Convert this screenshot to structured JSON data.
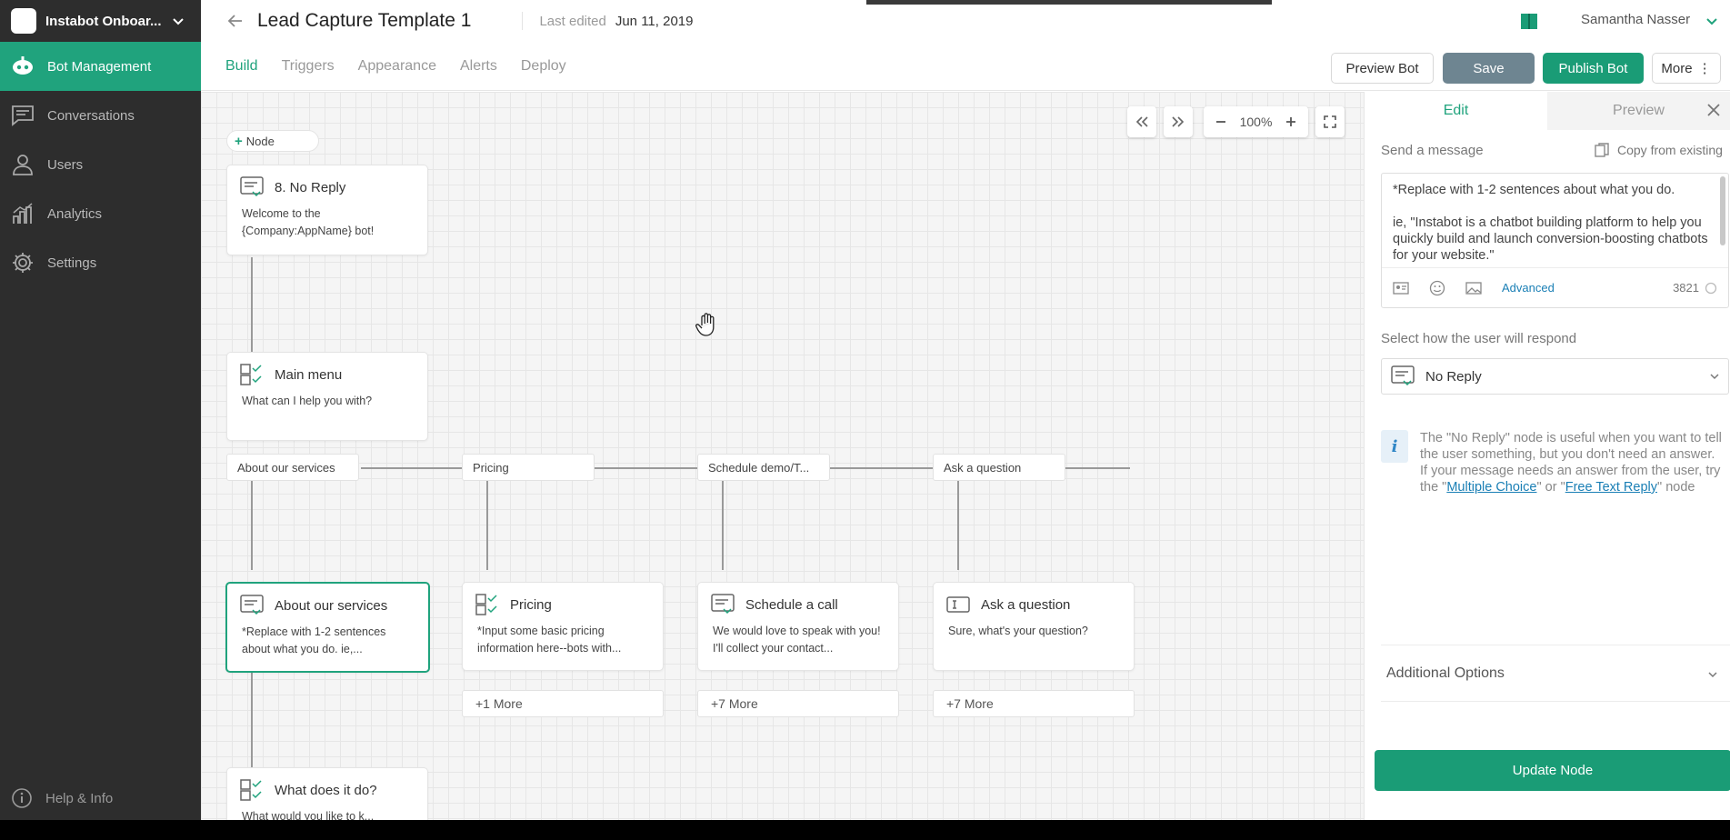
{
  "workspace": {
    "name": "Instabot Onboar..."
  },
  "sidebar": {
    "items": [
      {
        "label": "Bot Management",
        "icon": "bot-icon"
      },
      {
        "label": "Conversations",
        "icon": "chat-icon"
      },
      {
        "label": "Users",
        "icon": "user-icon"
      },
      {
        "label": "Analytics",
        "icon": "analytics-icon"
      },
      {
        "label": "Settings",
        "icon": "gear-icon"
      }
    ],
    "help_label": "Help & Info"
  },
  "header": {
    "title": "Lead Capture Template 1",
    "last_edited_label": "Last edited",
    "last_edited_date": "Jun 11, 2019",
    "user_name": "Samantha Nasser"
  },
  "tabs": [
    {
      "label": "Build"
    },
    {
      "label": "Triggers"
    },
    {
      "label": "Appearance"
    },
    {
      "label": "Alerts"
    },
    {
      "label": "Deploy"
    }
  ],
  "actions": {
    "preview": "Preview Bot",
    "save": "Save",
    "publish": "Publish Bot",
    "more": "More"
  },
  "canvas": {
    "zoom": "100%",
    "add_node_label": "Node",
    "nodes": {
      "no_reply": {
        "title": "8. No Reply",
        "body": "Welcome to the {Company:AppName} bot!"
      },
      "main_menu": {
        "title": "Main menu",
        "body": "What can I help you with?"
      },
      "about": {
        "title": "About our services",
        "body": "*Replace with 1-2 sentences about what you do. ie,..."
      },
      "pricing": {
        "title": "Pricing",
        "body": "*Input some basic pricing information here--bots with..."
      },
      "schedule": {
        "title": "Schedule a call",
        "body": "We would love to speak with you! I'll collect your contact..."
      },
      "ask": {
        "title": "Ask a question",
        "body": "Sure, what's your question?"
      },
      "what": {
        "title": "What does it do?",
        "body": "What would you like to k..."
      }
    },
    "options": [
      "About our services",
      "Pricing",
      "Schedule demo/T...",
      "Ask a question"
    ],
    "more_labels": [
      "+1 More",
      "+7 More",
      "+7 More"
    ]
  },
  "panel": {
    "tabs": [
      "Edit",
      "Preview"
    ],
    "send_message_label": "Send a message",
    "copy_label": "Copy from existing",
    "message": "*Replace with 1-2 sentences about what you do.\n\nie, \"Instabot is a chatbot building platform to help you quickly build and launch conversion-boosting chatbots for your website.\"",
    "advanced_label": "Advanced",
    "char_count": "3821",
    "respond_label": "Select how the user will respond",
    "respond_value": "No Reply",
    "info": {
      "p1": "The \"No Reply\" node is useful when you want to tell the user something, but you don't need an answer.",
      "p2_pre": "If your message needs an answer from the user, try the \"",
      "link1": "Multiple Choice",
      "p2_mid": "\" or \"",
      "link2": "Free Text Reply",
      "p2_post": "\" node"
    },
    "additional_options": "Additional Options",
    "update_button": "Update Node"
  },
  "colors": {
    "accent": "#20a37d",
    "sidebar": "#2d2d2d",
    "save": "#6e8591",
    "link": "#1a7fb5"
  }
}
